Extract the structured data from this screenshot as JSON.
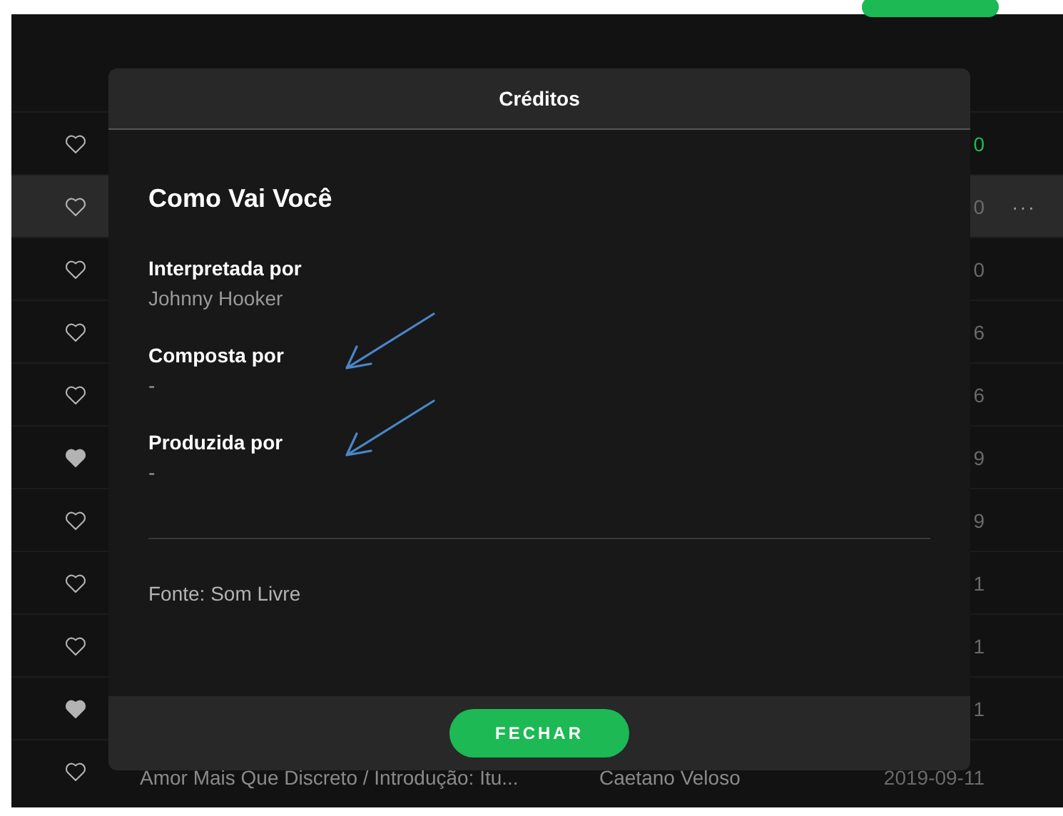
{
  "rows": [
    {
      "liked": false,
      "playing": true,
      "selected": false,
      "date": "0"
    },
    {
      "liked": false,
      "playing": false,
      "selected": true,
      "date": "0",
      "more": "···"
    },
    {
      "liked": false,
      "playing": false,
      "selected": false,
      "date": "0"
    },
    {
      "liked": false,
      "playing": false,
      "selected": false,
      "date": "6"
    },
    {
      "liked": false,
      "playing": false,
      "selected": false,
      "date": "6"
    },
    {
      "liked": true,
      "playing": false,
      "selected": false,
      "date": "9"
    },
    {
      "liked": false,
      "playing": false,
      "selected": false,
      "date": "9"
    },
    {
      "liked": false,
      "playing": false,
      "selected": false,
      "date": "1"
    },
    {
      "liked": false,
      "playing": false,
      "selected": false,
      "date": "1"
    },
    {
      "liked": true,
      "playing": false,
      "selected": false,
      "date": "1"
    },
    {
      "liked": false,
      "playing": false,
      "selected": false,
      "title": "Amor Mais Que Discreto / Introdução: Itu...",
      "artist": "Caetano Veloso",
      "date": "2019-09-11"
    }
  ],
  "dialog": {
    "title": "Créditos",
    "song": "Como Vai Você",
    "sections": [
      {
        "label": "Interpretada por",
        "value": "Johnny Hooker",
        "annotated": false
      },
      {
        "label": "Composta por",
        "value": "-",
        "annotated": true
      },
      {
        "label": "Produzida por",
        "value": "-",
        "annotated": true
      }
    ],
    "source": "Fonte: Som Livre",
    "button": "FECHAR"
  }
}
